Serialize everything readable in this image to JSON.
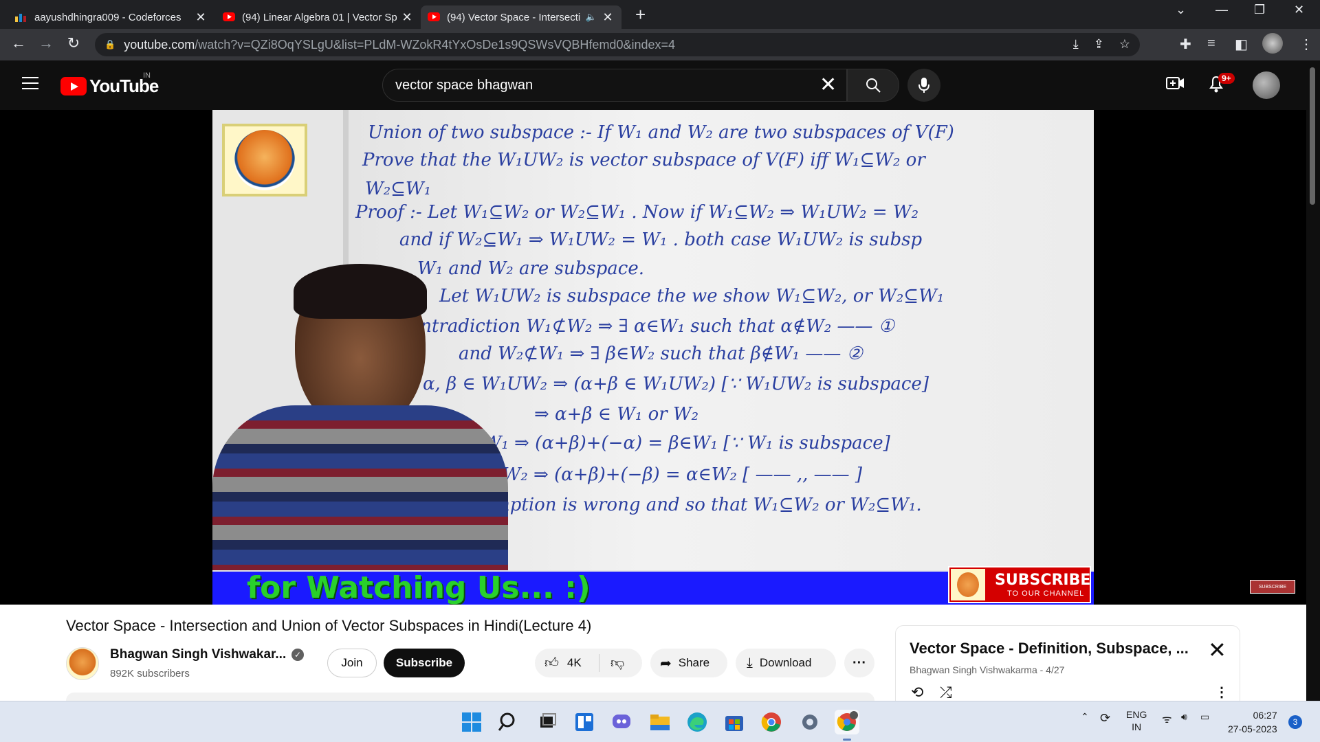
{
  "browser": {
    "tabs": [
      {
        "label": "aayushdhingra009 - Codeforces",
        "active": false
      },
      {
        "label": "(94) Linear Algebra 01 | Vector Sp",
        "active": false
      },
      {
        "label": "(94) Vector Space - Intersecti",
        "active": true
      }
    ],
    "url_host": "youtube.com",
    "url_rest": "/watch?v=QZi8OqYSLgU&list=PLdM-WZokR4tYxOsDe1s9QSWsVQBHfemd0&index=4"
  },
  "youtube": {
    "logo_word": "YouTube",
    "region": "IN",
    "search_value": "vector space bhagwan",
    "notification_count": "9+"
  },
  "video": {
    "board_lines": [
      "Union of two subspace :- If W₁ and W₂ are two subspaces of V(F)",
      "Prove that  the  W₁UW₂ is vector subspace of  V(F)  iff  W₁⊆W₂ or",
      "W₂⊆W₁",
      "Proof :- Let   W₁⊆W₂  or  W₂⊆W₁ . Now if  W₁⊆W₂ ⇒ W₁UW₂ = W₂",
      "and if  W₂⊆W₁ ⇒  W₁UW₂ = W₁ .  both case  W₁UW₂ is subsp",
      "W₁ and W₂ are subspace.",
      "Let W₁UW₂ is subspace  the we show  W₁⊆W₂, or W₂⊆W₁",
      "contradiction   W₁⊄W₂ ⇒ ∃ α∈W₁ such that α∉W₂ —— ①",
      "and   W₂⊄W₁ ⇒ ∃ β∈W₂ such that β∉W₁ —— ②",
      "α, β ∈ W₁UW₂   ⇒ (α+β ∈ W₁UW₂) [∵ W₁UW₂ is subspace]",
      "⇒  α+β ∈ W₁ or W₂",
      "α+β∈W₁ ⇒ (α+β)+(−α) = β∈W₁ [∵ W₁ is subspace]",
      "α+β∈W₂ ⇒ (α+β)+(−β) = α∈W₂ [ —— ,, —— ]",
      "sumption is wrong  and so that  W₁⊆W₂ or W₂⊆W₁."
    ],
    "banner_text": "for Watching Us... :)",
    "subscribe_overlay": "SUBSCRIBE",
    "subscribe_overlay_sub": "TO OUR CHANNEL",
    "watermark": "SUBSCRIBE"
  },
  "details": {
    "title": "Vector Space - Intersection and Union of Vector Subspaces in Hindi(Lecture 4)",
    "channel_name": "Bhagwan Singh Vishwakar...",
    "subscribers": "892K subscribers",
    "join_label": "Join",
    "subscribe_label": "Subscribe",
    "likes": "4K",
    "share_label": "Share",
    "download_label": "Download"
  },
  "playlist": {
    "title": "Vector Space - Definition, Subspace, ...",
    "meta": "Bhagwan Singh Vishwakarma - 4/27"
  },
  "taskbar": {
    "lang": "ENG",
    "region": "IN",
    "time": "06:27",
    "date": "27-05-2023",
    "notifications": "3"
  }
}
